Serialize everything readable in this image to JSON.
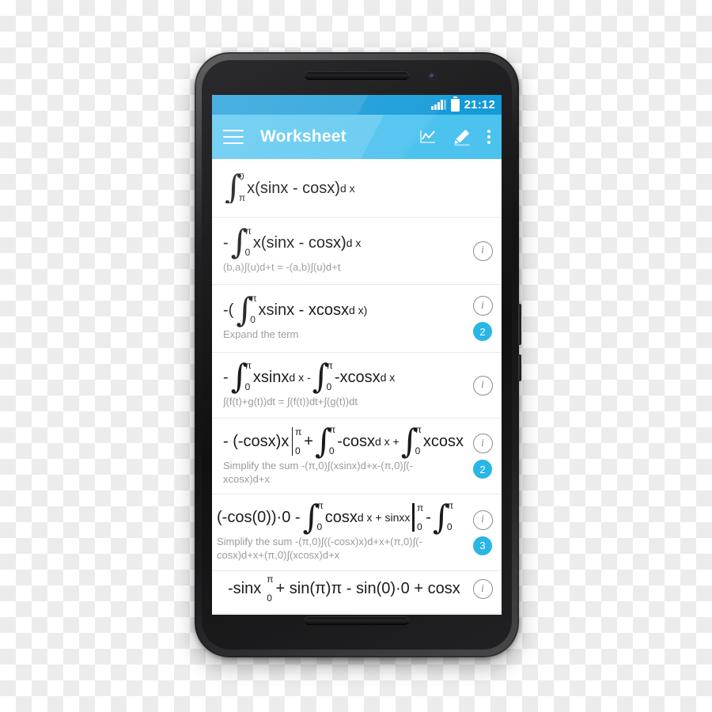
{
  "status_bar": {
    "time": "21:12",
    "signal_icon": "signal-bars-icon",
    "battery_icon": "battery-icon"
  },
  "toolbar": {
    "title": "Worksheet",
    "menu_icon": "hamburger-menu-icon",
    "graph_icon": "graph-chart-icon",
    "edit_icon": "pencil-edit-icon",
    "overflow_icon": "overflow-menu-icon"
  },
  "colors": {
    "status_bar": "#149ad8",
    "toolbar": "#4cc2ef",
    "badge": "#29b6e5",
    "info_icon": "#8c8c8c",
    "subtitle": "#9b9b9b",
    "nav_bar": "#dcdcdc"
  },
  "rows": [
    {
      "expression_parts": {
        "lead": "",
        "upper": "0",
        "lower": "π",
        "body": "x(sinx - cosx)",
        "dx": "d x"
      },
      "subtitle": "",
      "info": false,
      "badge": null
    },
    {
      "expression_parts": {
        "lead": "-",
        "upper": "π",
        "lower": "0",
        "body": "x(sinx - cosx)",
        "dx": "d x"
      },
      "subtitle": "(b,a)∫(u)d+t = -(a,b)∫(u)d+t",
      "info": true,
      "badge": null
    },
    {
      "expression_parts": {
        "lead": "-(",
        "upper": "π",
        "lower": "0",
        "body": "xsinx - xcosx",
        "dx": "d x)"
      },
      "subtitle": "Expand the term",
      "info": true,
      "badge": "2"
    },
    {
      "expression_parts": {
        "lead": "-",
        "upper": "π",
        "lower": "0",
        "body": "xsinx",
        "dx": "d x -",
        "upper2": "π",
        "lower2": "0",
        "body2": "-xcosx",
        "dx2": "d x"
      },
      "subtitle": "∫(f(t)+g(t))dt = ∫(f(t))dt+∫(g(t))dt",
      "info": true,
      "badge": null
    },
    {
      "expression_parts": {
        "lead": "- (-cosx)x",
        "eval_up": "π",
        "eval_lo": "0",
        "plus": "+",
        "upper": "π",
        "lower": "0",
        "body": "-cosx",
        "dx": "d x +",
        "upper2": "π",
        "lower2": "0",
        "body2": "xcosx"
      },
      "subtitle": "Simplify the sum -(π,0)∫(xsinx)d+x-(π,0)∫(-xcosx)d+x",
      "info": true,
      "badge": "2"
    },
    {
      "expression_parts": {
        "lead": "(-cos(0))·0 -",
        "upper": "π",
        "lower": "0",
        "body": "cosx",
        "dx": "d x +  sinxx",
        "eval_up": "π",
        "eval_lo": "0",
        "minus": "-",
        "upper2": "π",
        "lower2": "0"
      },
      "subtitle": "Simplify the sum -(π,0)∫((-cosx)x)d+x+(π,0)∫(-cosx)d+x+(π,0)∫(xcosx)d+x",
      "info": true,
      "badge": "3"
    },
    {
      "expression_parts": {
        "lead": "-sinx",
        "eval_up": "π",
        "eval_lo": "0",
        "tail": "+ sin(π)π - sin(0)·0 +  cosx"
      },
      "subtitle": "",
      "info": true,
      "badge": null
    }
  ],
  "nav_bar": {
    "back_icon": "nav-back-triangle-icon",
    "home_icon": "nav-home-circle-icon",
    "recents_icon": "nav-recents-square-icon"
  }
}
